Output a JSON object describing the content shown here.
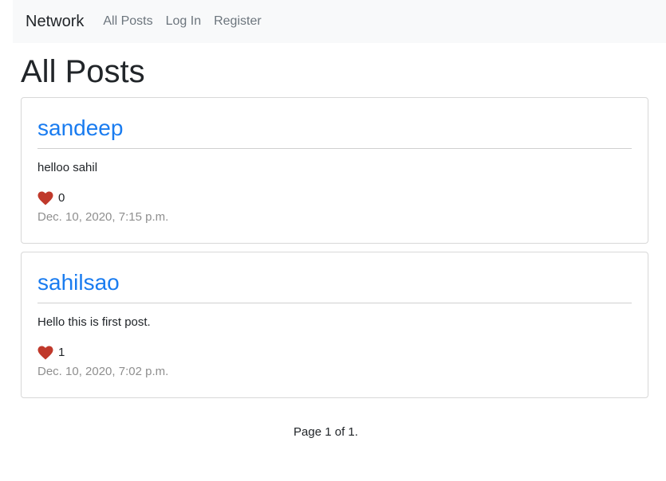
{
  "navbar": {
    "brand": "Network",
    "links": [
      "All Posts",
      "Log In",
      "Register"
    ]
  },
  "page": {
    "title": "All Posts"
  },
  "posts": [
    {
      "author": "sandeep",
      "content": "helloo sahil",
      "likes": "0",
      "timestamp": "Dec. 10, 2020, 7:15 p.m."
    },
    {
      "author": "sahilsao",
      "content": "Hello this is first post.",
      "likes": "1",
      "timestamp": "Dec. 10, 2020, 7:02 p.m."
    }
  ],
  "pagination": {
    "text": "Page 1 of 1."
  },
  "colors": {
    "link_blue": "#1a7cf0",
    "heart_red": "#c0392b",
    "muted_gray": "#8f8f8f",
    "navbar_bg": "#f8f9fa"
  },
  "icons": {
    "like": "heart-icon"
  }
}
